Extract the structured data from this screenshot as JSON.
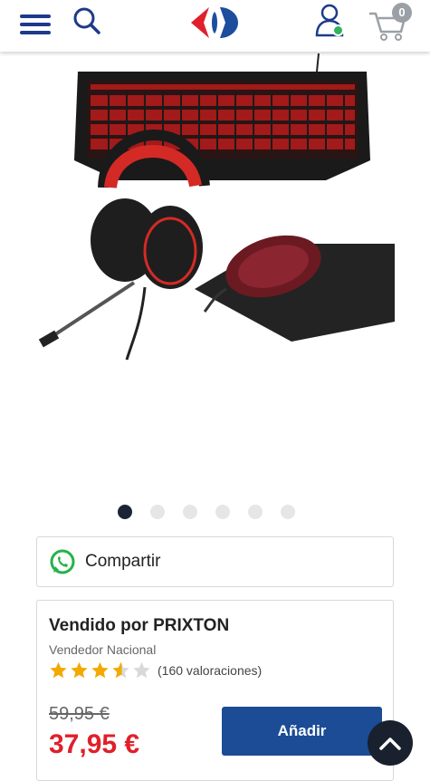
{
  "header": {
    "menu_icon": "hamburger-menu-icon",
    "search_icon": "search-icon",
    "logo": "carrefour-logo",
    "account_icon": "user-account-icon",
    "cart_icon": "shopping-cart-icon",
    "cart_count": "0",
    "accent_color": "#1d3a8a"
  },
  "gallery": {
    "image": "gaming kit: keyboard, headset, mouse and mouse pad",
    "slide_count": 6,
    "active_slide": 1
  },
  "share": {
    "icon": "whatsapp-icon",
    "label": "Compartir"
  },
  "seller": {
    "prefix": "Vendido por",
    "name": "PRIXTON",
    "type": "Vendedor Nacional",
    "rating_stars": 3.5,
    "rating_max": 5,
    "reviews": "(160 valoraciones)"
  },
  "price": {
    "old": "59,95 €",
    "current": "37,95 €",
    "current_color": "#e0202a"
  },
  "actions": {
    "add_label": "Añadir",
    "add_color": "#1b4c95",
    "scroll_top_icon": "chevron-up-icon"
  }
}
